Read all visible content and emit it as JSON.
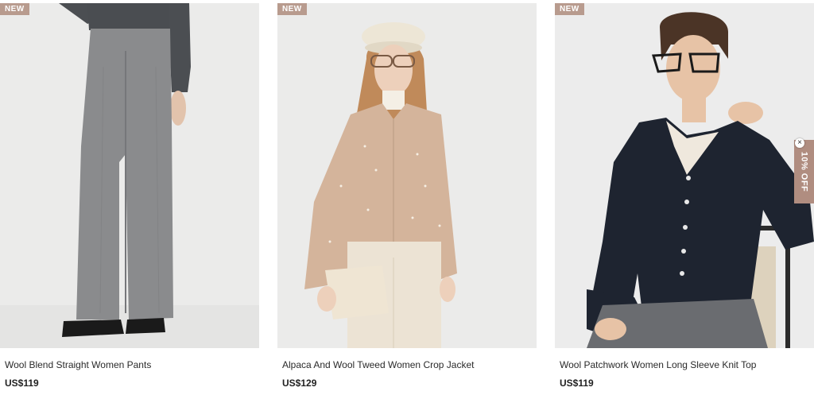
{
  "products": [
    {
      "badge": "NEW",
      "name": "Wool Blend Straight Women Pants",
      "price": "US$119"
    },
    {
      "badge": "NEW",
      "name": "Alpaca And Wool Tweed Women Crop Jacket",
      "price": "US$129"
    },
    {
      "badge": "NEW",
      "name": "Wool Patchwork Women Long Sleeve Knit Top",
      "price": "US$119"
    }
  ],
  "promo": {
    "label": "10% OFF",
    "close_symbol": "×"
  },
  "colors": {
    "badge_bg": "#b89b8e",
    "promo_bg": "#b08d80",
    "photo_bg": "#ebebeb"
  }
}
